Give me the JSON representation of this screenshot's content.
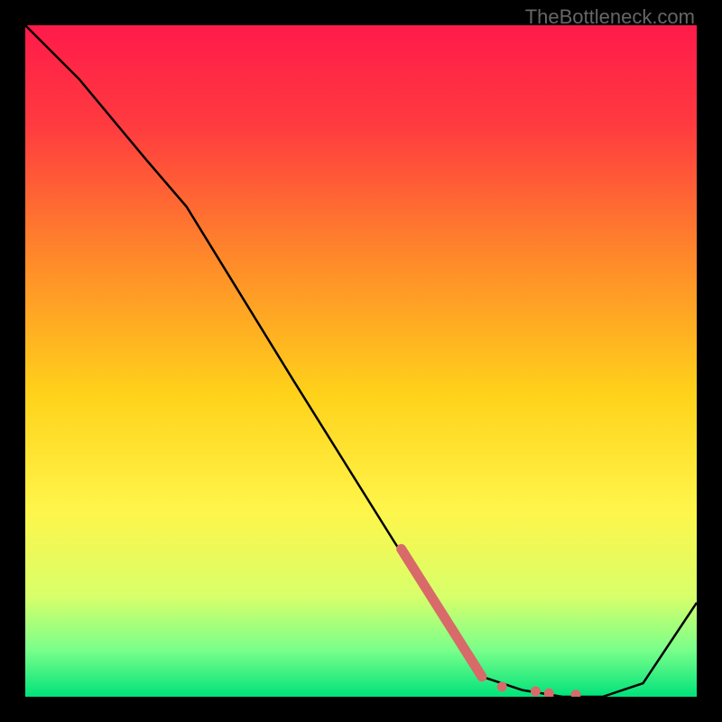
{
  "watermark": "TheBottleneck.com",
  "chart_data": {
    "type": "line",
    "title": "",
    "xlabel": "",
    "ylabel": "",
    "xlim": [
      0,
      100
    ],
    "ylim": [
      0,
      100
    ],
    "gradient_stops": [
      {
        "offset": 0.0,
        "color": "#ff1a4a"
      },
      {
        "offset": 0.15,
        "color": "#ff3b3f"
      },
      {
        "offset": 0.35,
        "color": "#ff8a2a"
      },
      {
        "offset": 0.55,
        "color": "#ffd21a"
      },
      {
        "offset": 0.72,
        "color": "#fff54a"
      },
      {
        "offset": 0.85,
        "color": "#d8ff6a"
      },
      {
        "offset": 0.93,
        "color": "#7aff8a"
      },
      {
        "offset": 1.0,
        "color": "#00e27a"
      }
    ],
    "series": [
      {
        "name": "curve",
        "x": [
          0,
          8,
          18,
          24,
          40,
          55,
          68,
          74,
          80,
          86,
          92,
          100
        ],
        "y": [
          100,
          92,
          80,
          73,
          47,
          23,
          3,
          1,
          0,
          0,
          2,
          14
        ]
      }
    ],
    "markers": {
      "thick_segment": {
        "x": [
          56,
          68
        ],
        "y": [
          22,
          3
        ]
      },
      "dots": [
        {
          "x": 71,
          "y": 1.5
        },
        {
          "x": 76,
          "y": 0.8
        },
        {
          "x": 78,
          "y": 0.5
        },
        {
          "x": 82,
          "y": 0.3
        }
      ],
      "color": "#d86a6a"
    }
  }
}
